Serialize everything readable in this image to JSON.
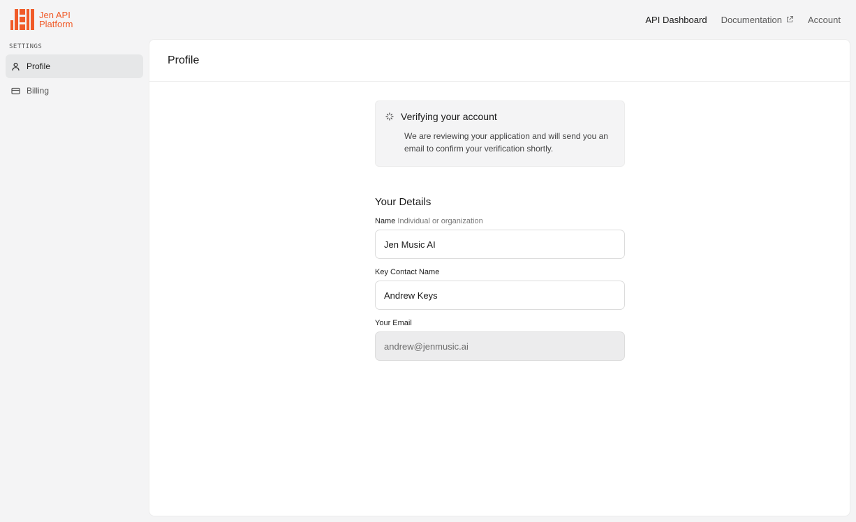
{
  "brand": {
    "line1": "Jen API",
    "line2": "Platform",
    "color": "#f05a28"
  },
  "nav": {
    "dashboard": "API Dashboard",
    "documentation": "Documentation",
    "account": "Account"
  },
  "sidebar": {
    "section_label": "SETTINGS",
    "items": [
      {
        "label": "Profile",
        "icon": "user-icon",
        "selected": true
      },
      {
        "label": "Billing",
        "icon": "credit-card-icon",
        "selected": false
      }
    ]
  },
  "main": {
    "title": "Profile",
    "notice": {
      "title": "Verifying your account",
      "body": "We are reviewing your application and will send you an email to confirm your verification shortly.",
      "icon": "loader-icon"
    },
    "details": {
      "title": "Your Details",
      "name_label": "Name",
      "name_hint": "Individual or organization",
      "name_value": "Jen Music AI",
      "contact_label": "Key Contact Name",
      "contact_value": "Andrew Keys",
      "email_label": "Your Email",
      "email_value": "andrew@jenmusic.ai"
    }
  }
}
